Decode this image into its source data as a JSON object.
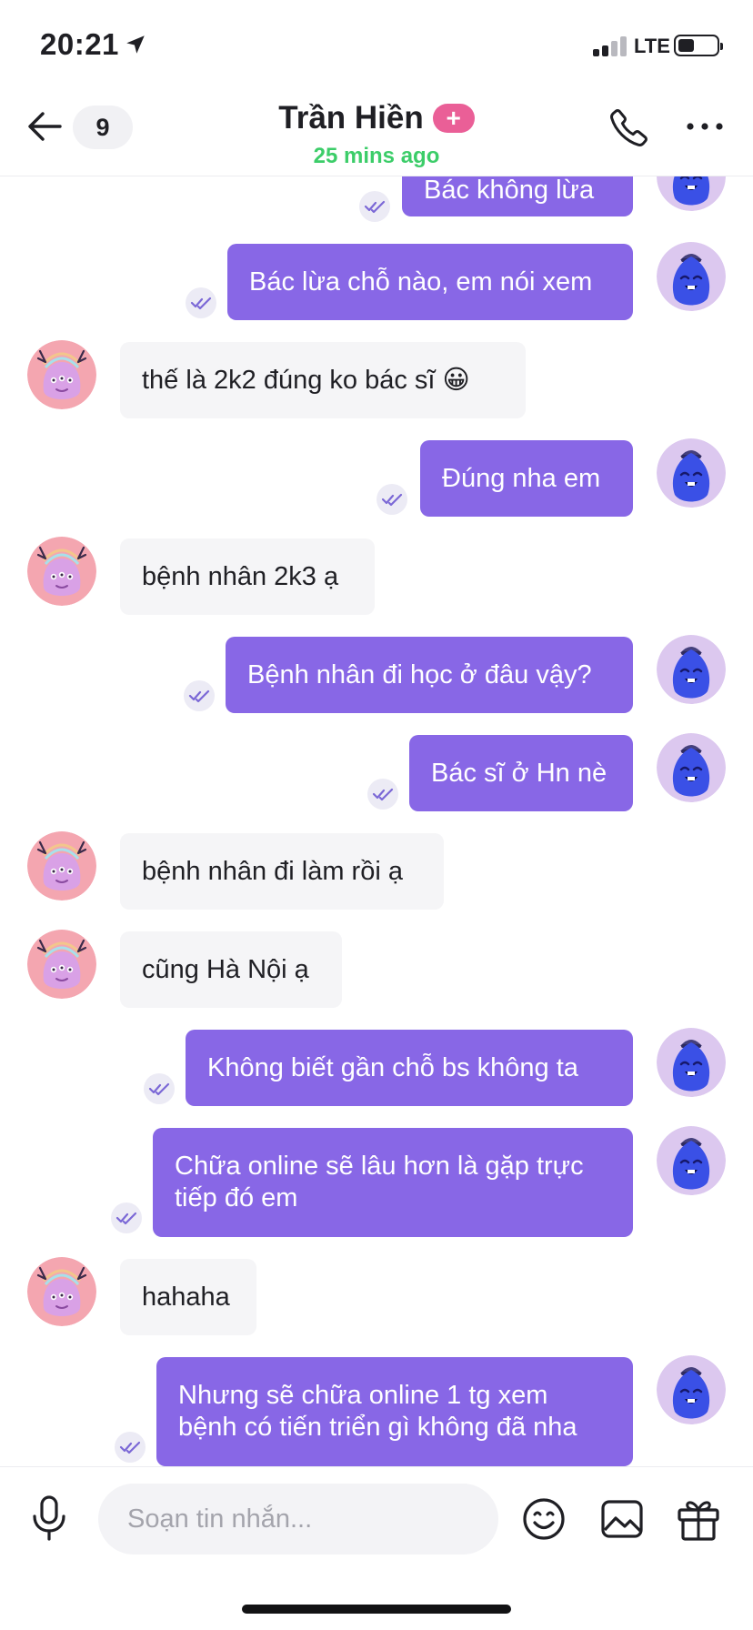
{
  "status_bar": {
    "time": "20:21",
    "network": "LTE"
  },
  "header": {
    "unread_count": "9",
    "contact_name": "Trần Hiền",
    "plus_badge": "+",
    "presence": "25 mins ago"
  },
  "colors": {
    "outgoing_bubble": "#8867e6",
    "incoming_bubble": "#f5f5f7",
    "presence": "#3ccd69",
    "plus_badge": "#ea5f97"
  },
  "messages": [
    {
      "side": "out",
      "text": "Bác không lừa"
    },
    {
      "side": "out",
      "text": "Bác lừa chỗ nào, em nói xem"
    },
    {
      "side": "in",
      "text": "thế là 2k2 đúng ko bác sĩ 😀"
    },
    {
      "side": "out",
      "text": "Đúng nha em"
    },
    {
      "side": "in",
      "text": "bệnh nhân 2k3 ạ"
    },
    {
      "side": "out",
      "text": "Bệnh nhân đi học ở đâu vậy?"
    },
    {
      "side": "out",
      "text": "Bác sĩ ở Hn nè"
    },
    {
      "side": "in",
      "text": "bệnh nhân đi làm rồi ạ"
    },
    {
      "side": "in",
      "text": "cũng Hà Nội ạ"
    },
    {
      "side": "out",
      "text": "Không biết gần chỗ bs không ta"
    },
    {
      "side": "out",
      "text": "Chữa online sẽ lâu hơn là gặp trực tiếp đó em"
    },
    {
      "side": "in",
      "text": "hahaha"
    },
    {
      "side": "out",
      "text": "Nhưng sẽ chữa online 1 tg xem bệnh có tiến triển gì không đã nha"
    }
  ],
  "composer": {
    "placeholder": "Soạn tin nhắn..."
  },
  "icons": {
    "back": "arrow-left-icon",
    "call": "phone-icon",
    "more": "more-dots-icon",
    "mic": "microphone-icon",
    "emoji": "smiley-icon",
    "image": "image-icon",
    "gift": "gift-icon",
    "read_receipt": "double-check-icon",
    "contact_avatar": "pink-monster-avatar",
    "self_avatar": "blue-monster-avatar"
  }
}
